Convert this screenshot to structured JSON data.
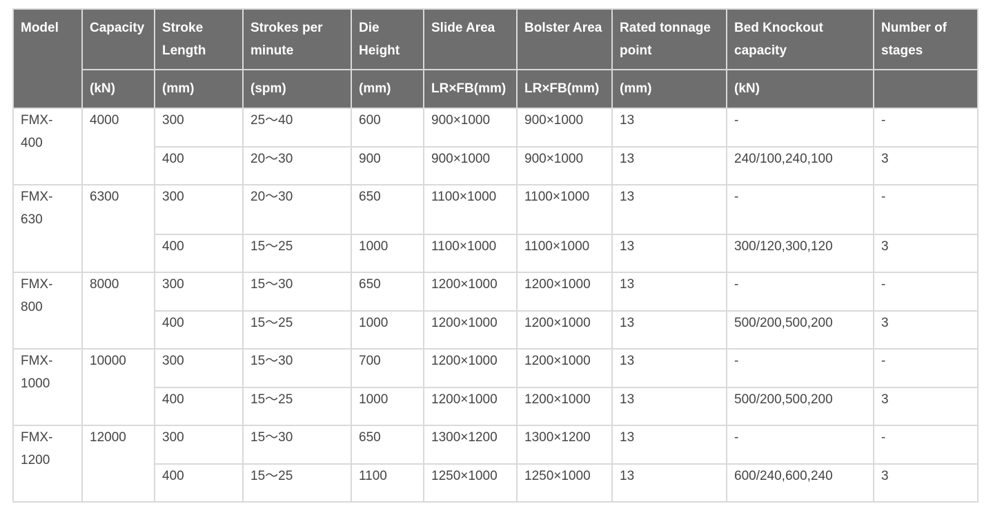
{
  "header": {
    "row1": [
      "Model",
      "Capacity",
      "Stroke Length",
      "Strokes per minute",
      "Die Height",
      "Slide Area",
      "Bolster Area",
      "Rated tonnage point",
      "Bed Knockout capacity",
      "Number of stages"
    ],
    "row2": [
      "(kN)",
      "(mm)",
      "(spm)",
      "(mm)",
      "LR×FB(mm)",
      "LR×FB(mm)",
      "(mm)",
      "(kN)",
      ""
    ]
  },
  "models": [
    {
      "model": "FMX-400",
      "capacity": "4000",
      "rows": [
        [
          "300",
          "25～40",
          "600",
          "900×1000",
          "900×1000",
          "13",
          "-",
          "-"
        ],
        [
          "400",
          "20～30",
          "900",
          "900×1000",
          "900×1000",
          "13",
          "240/100,240,100",
          "3"
        ]
      ]
    },
    {
      "model": "FMX-630",
      "capacity": "6300",
      "rows": [
        [
          "300",
          "20～30",
          "650",
          "1100×1000",
          "1100×1000",
          "13",
          "-",
          "-"
        ],
        [
          "400",
          "15～25",
          "1000",
          "1100×1000",
          "1100×1000",
          "13",
          "300/120,300,120",
          "3"
        ]
      ]
    },
    {
      "model": "FMX-800",
      "capacity": "8000",
      "rows": [
        [
          "300",
          "15～30",
          "650",
          "1200×1000",
          "1200×1000",
          "13",
          "-",
          "-"
        ],
        [
          "400",
          "15～25",
          "1000",
          "1200×1000",
          "1200×1000",
          "13",
          "500/200,500,200",
          "3"
        ]
      ]
    },
    {
      "model": "FMX-1000",
      "capacity": "10000",
      "rows": [
        [
          "300",
          "15～30",
          "700",
          "1200×1000",
          "1200×1000",
          "13",
          "-",
          "-"
        ],
        [
          "400",
          "15～25",
          "1000",
          "1200×1000",
          "1200×1000",
          "13",
          "500/200,500,200",
          "3"
        ]
      ]
    },
    {
      "model": "FMX-1200",
      "capacity": "12000",
      "rows": [
        [
          "300",
          "15～30",
          "650",
          "1300×1200",
          "1300×1200",
          "13",
          "-",
          "-"
        ],
        [
          "400",
          "15～25",
          "1100",
          "1250×1000",
          "1250×1000",
          "13",
          "600/240,600,240",
          "3"
        ]
      ]
    }
  ]
}
